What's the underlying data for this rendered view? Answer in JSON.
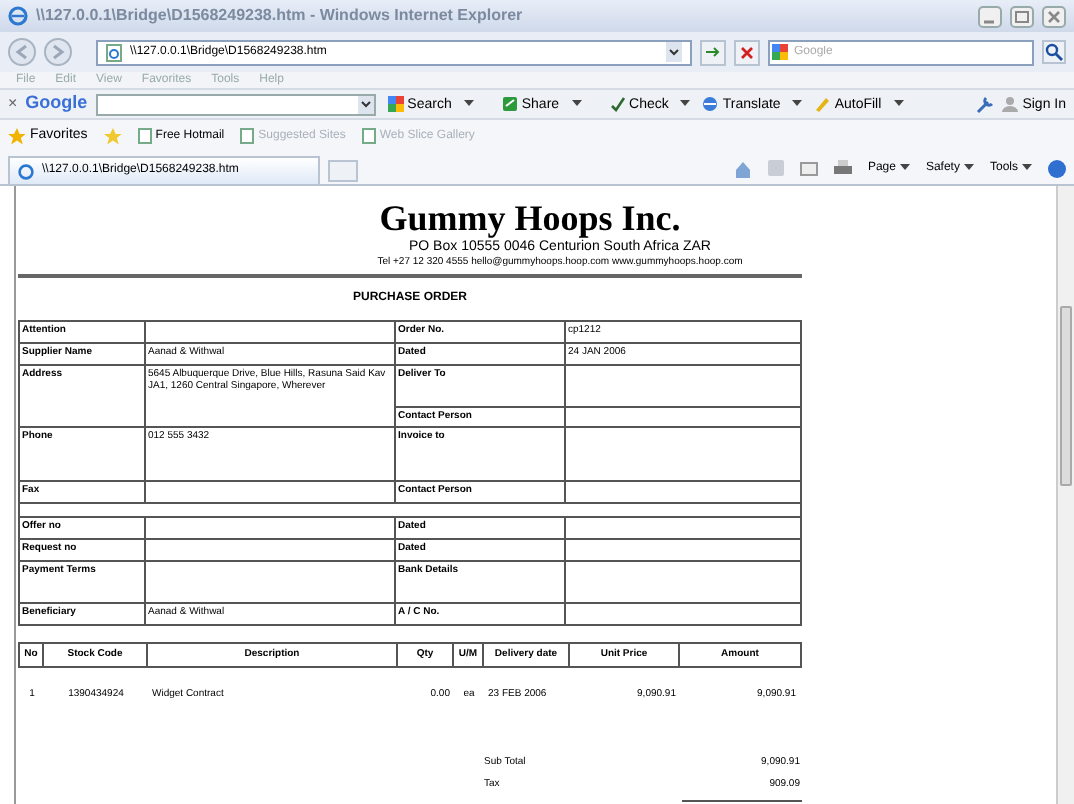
{
  "window": {
    "title": "\\\\127.0.0.1\\Bridge\\D1568249238.htm - Windows Internet Explorer"
  },
  "address_bar": {
    "value": "\\\\127.0.0.1\\Bridge\\D1568249238.htm",
    "search_placeholder": "Google"
  },
  "menu": [
    "File",
    "Edit",
    "View",
    "Favorites",
    "Tools",
    "Help"
  ],
  "google_toolbar": {
    "close": "×",
    "logo": "Google",
    "items": [
      {
        "kind": "search",
        "label": "Search"
      },
      {
        "kind": "share",
        "label": "Share"
      },
      {
        "kind": "check",
        "label": "Check"
      },
      {
        "kind": "translate",
        "label": "Translate"
      },
      {
        "kind": "autofill",
        "label": "AutoFill"
      }
    ],
    "sign_in": "Sign In"
  },
  "favorites_bar": {
    "label": "Favorites",
    "links": [
      {
        "label": "Free Hotmail",
        "disabled": false
      },
      {
        "label": "Suggested Sites",
        "disabled": true
      },
      {
        "label": "Web Slice Gallery",
        "disabled": true
      }
    ]
  },
  "tab": {
    "title": "\\\\127.0.0.1\\Bridge\\D1568249238.htm",
    "selected": true
  },
  "command_bar": [
    "Page",
    "Safety",
    "Tools"
  ],
  "document": {
    "company": "Gummy Hoops Inc.",
    "address": "PO Box 10555 0046 Centurion South Africa ZAR",
    "contact": "Tel +27 12 320 4555 hello@gummyhoops.hoop.com www.gummyhoops.hoop.com",
    "heading": "PURCHASE ORDER",
    "blocks": [
      [
        {
          "label": "Attention",
          "right": [
            {
              "label": "Order No.",
              "value": "cp1212",
              "kind": "short"
            }
          ]
        },
        {
          "label": "Supplier Name",
          "value": "Aanad & Withwal",
          "right": [
            {
              "label": "Dated",
              "value": "24 JAN 2006",
              "kind": "short"
            }
          ]
        },
        {
          "label": "Address",
          "value": "5645 Albuquerque Drive, Blue Hills, Rasuna Said Kav JA1, 1260 Central Singapore, Wherever",
          "right": [
            {
              "label": "Deliver To",
              "kind": "tall"
            },
            {
              "label": "Contact Person",
              "kind": "short"
            }
          ]
        },
        {
          "label": "Phone",
          "value": "012 555 3432",
          "right": [
            {
              "label": "Invoice to",
              "kind": "taller"
            }
          ]
        },
        {
          "label": "Fax",
          "right": [
            {
              "label": "Contact Person",
              "kind": "short"
            }
          ]
        }
      ],
      [
        {
          "label": "Offer no",
          "right": [
            {
              "label": "Dated",
              "kind": "short"
            }
          ]
        },
        {
          "label": "Request no",
          "right": [
            {
              "label": "Dated",
              "kind": "short"
            }
          ]
        },
        {
          "label": "Payment Terms",
          "right": [
            {
              "label": "Bank Details",
              "kind": "tall"
            }
          ]
        },
        {
          "label": "Beneficiary",
          "value": "Aanad & Withwal",
          "right": [
            {
              "label": "A / C No.",
              "kind": "short"
            }
          ]
        }
      ]
    ],
    "items": {
      "columns": [
        "No",
        "Stock Code",
        "Description",
        "Qty",
        "U/M",
        "Delivery date",
        "Unit Price",
        "Amount"
      ],
      "rows": [
        [
          "1",
          "1390434924",
          "Widget Contract",
          "0.00",
          "ea",
          "23 FEB 2006",
          "9,090.91",
          "9,090.91"
        ]
      ]
    },
    "totals": [
      {
        "label": "Sub Total",
        "value": "9,090.91"
      },
      {
        "label": "Tax",
        "value": "909.09"
      }
    ]
  }
}
